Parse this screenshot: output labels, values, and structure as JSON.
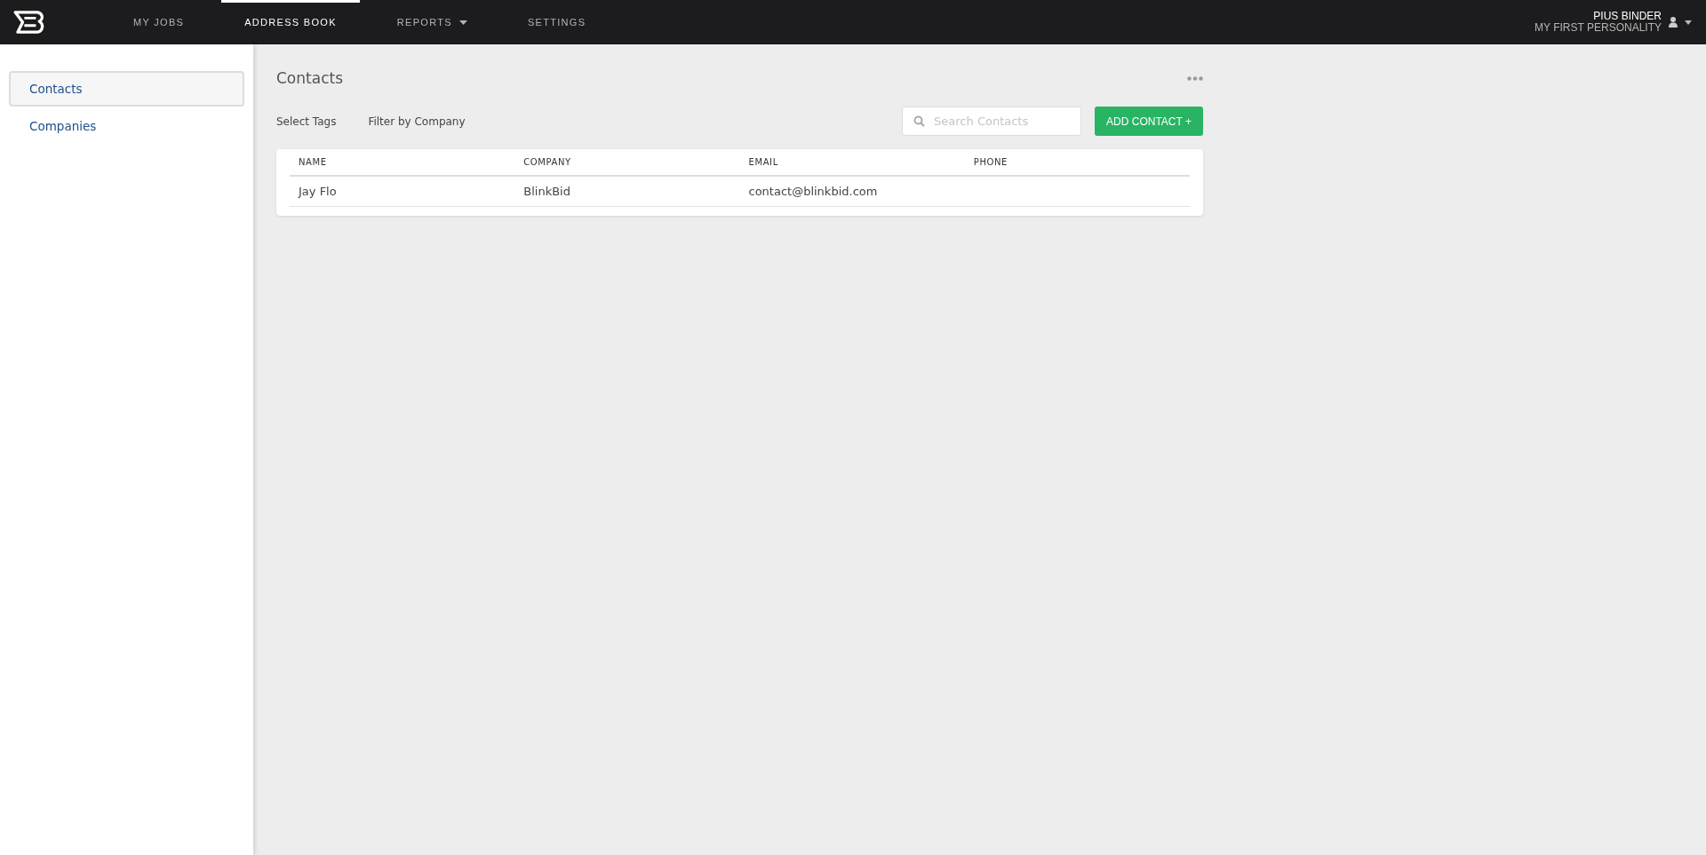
{
  "nav": {
    "items": [
      {
        "label": "MY JOBS",
        "selected": false,
        "dropdown": false
      },
      {
        "label": "ADDRESS BOOK",
        "selected": true,
        "dropdown": false
      },
      {
        "label": "REPORTS",
        "selected": false,
        "dropdown": true
      },
      {
        "label": "SETTINGS",
        "selected": false,
        "dropdown": false
      }
    ],
    "user": {
      "name": "PIUS BINDER",
      "personality": "MY FIRST PERSONALITY"
    }
  },
  "sidebar": {
    "items": [
      {
        "label": "Contacts",
        "selected": true
      },
      {
        "label": "Companies",
        "selected": false
      }
    ]
  },
  "page": {
    "title": "Contacts",
    "filters": [
      "Select Tags",
      "Filter by Company"
    ],
    "search": {
      "placeholder": "Search Contacts"
    },
    "add_button": "ADD CONTACT +"
  },
  "table": {
    "columns": [
      "NAME",
      "COMPANY",
      "EMAIL",
      "PHONE"
    ],
    "rows": [
      [
        "Jay Flo",
        "BlinkBid",
        "contact@blinkbid.com",
        ""
      ]
    ]
  }
}
